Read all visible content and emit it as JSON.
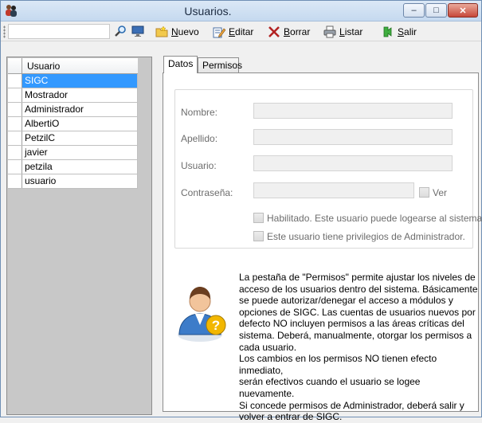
{
  "window": {
    "title": "Usuarios.",
    "controls": {
      "minimize": "–",
      "maximize": "□",
      "close": "✕"
    }
  },
  "toolbar": {
    "search_value": "",
    "buttons": [
      {
        "key": "N",
        "rest": "uevo",
        "label": "Nuevo",
        "icon": "folder-new-icon"
      },
      {
        "key": "E",
        "rest": "ditar",
        "label": "Editar",
        "icon": "edit-icon"
      },
      {
        "key": "B",
        "rest": "orrar",
        "label": "Borrar",
        "icon": "delete-x-icon"
      },
      {
        "key": "L",
        "rest": "istar",
        "label": "Listar",
        "icon": "printer-icon"
      },
      {
        "key": "S",
        "rest": "alir",
        "label": "Salir",
        "icon": "exit-arrow-icon"
      }
    ]
  },
  "users_grid": {
    "column_header": "Usuario",
    "rows": [
      "SIGC",
      "Mostrador",
      "Administrador",
      "AlbertiO",
      "PetzilC",
      "javier",
      "petzila",
      "usuario"
    ],
    "selected_index": 0
  },
  "tabs": [
    {
      "label": "Datos",
      "active": true
    },
    {
      "label": "Permisos",
      "active": false
    }
  ],
  "form": {
    "nombre_label": "Nombre:",
    "apellido_label": "Apellido:",
    "usuario_label": "Usuario:",
    "contrasena_label": "Contraseña:",
    "ver_label": "Ver",
    "habilitado_label": "Habilitado. Este usuario puede logearse al sistema.",
    "admin_label": "Este usuario tiene privilegios de Administrador.",
    "nombre_value": "",
    "apellido_value": "",
    "usuario_value": "",
    "contrasena_value": ""
  },
  "help": {
    "text": "La pestaña de \"Permisos\" permite ajustar los niveles de\nacceso de los usuarios dentro del sistema. Básicamente\nse puede autorizar/denegar el acceso a módulos y\nopciones de SIGC. Las cuentas de usuarios nuevos por\ndefecto NO incluyen permisos a las áreas críticas del\nsistema. Deberá, manualmente, otorgar los permisos a\ncada usuario.\nLos cambios en los permisos NO tienen efecto inmediato,\nserán efectivos cuando el usuario se logee nuevamente.\nSi concede permisos de Administrador, deberá salir y\nvolver a entrar de SIGC."
  },
  "colors": {
    "selection": "#3399ff",
    "title_bar": "#c5d9ef",
    "close_button": "#c7483a"
  }
}
